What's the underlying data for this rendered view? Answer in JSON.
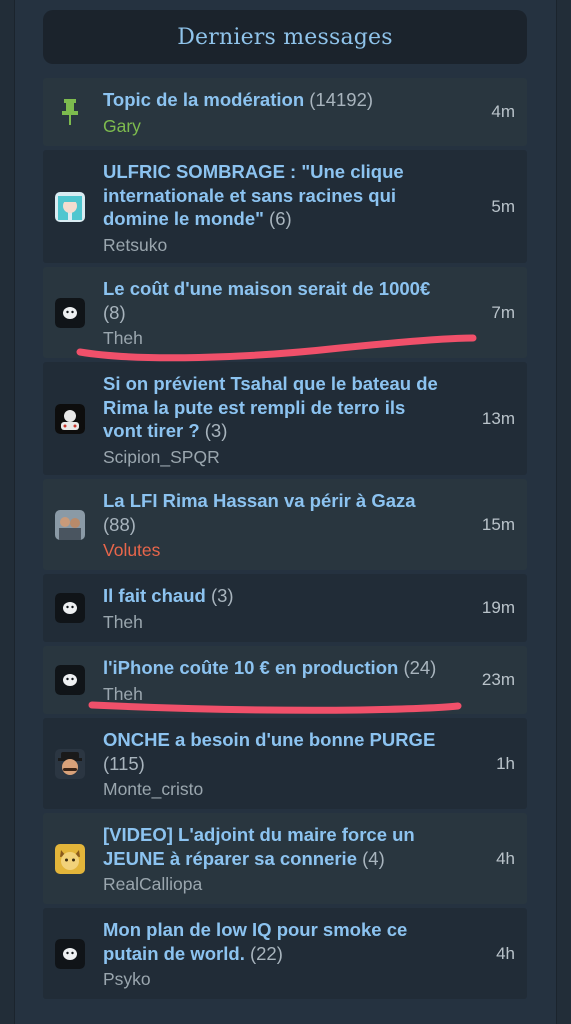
{
  "header": {
    "title": "Derniers messages"
  },
  "topics": [
    {
      "title": "Topic de la modération",
      "count": "(14192)",
      "author": "Gary",
      "time": "4m",
      "avatar": "pin-icon"
    },
    {
      "title": "ULFRIC SOMBRAGE : \"Une clique internationale et sans racines qui domine le monde\"",
      "count": "(6)",
      "author": "Retsuko",
      "time": "5m",
      "avatar": "anime-avatar"
    },
    {
      "title": "Le coût d'une maison serait de 1000€",
      "count": "(8)",
      "author": "Theh",
      "time": "7m",
      "avatar": "default-avatar"
    },
    {
      "title": "Si on prévient Tsahal que le bateau de Rima la pute est rempli de terro ils vont tirer ?",
      "count": "(3)",
      "author": "Scipion_SPQR",
      "time": "13m",
      "avatar": "gamer-avatar"
    },
    {
      "title": "La LFI Rima Hassan va périr à Gaza",
      "count": "(88)",
      "author": "Volutes",
      "time": "15m",
      "avatar": "photo-avatar"
    },
    {
      "title": "Il fait chaud",
      "count": "(3)",
      "author": "Theh",
      "time": "19m",
      "avatar": "default-avatar"
    },
    {
      "title": "l'iPhone coûte 10 € en production",
      "count": "(24)",
      "author": "Theh",
      "time": "23m",
      "avatar": "default-avatar"
    },
    {
      "title": "ONCHE a besoin d'une bonne PURGE",
      "count": "(115)",
      "author": "Monte_cristo",
      "time": "1h",
      "avatar": "mustache-avatar"
    },
    {
      "title": "[VIDEO] L'adjoint du maire force un JEUNE à réparer sa connerie",
      "count": "(4)",
      "author": "RealCalliopa",
      "time": "4h",
      "avatar": "cat-avatar"
    },
    {
      "title": "Mon plan de low IQ pour smoke ce putain de world.",
      "count": "(22)",
      "author": "Psyko",
      "time": "4h",
      "avatar": "default-avatar"
    }
  ],
  "colors": {
    "background": "#253240",
    "link": "#8cc3f0",
    "moderator": "#7dbb4e",
    "highlight_user": "#e8664b",
    "annotation_stroke": "#f0506a"
  }
}
